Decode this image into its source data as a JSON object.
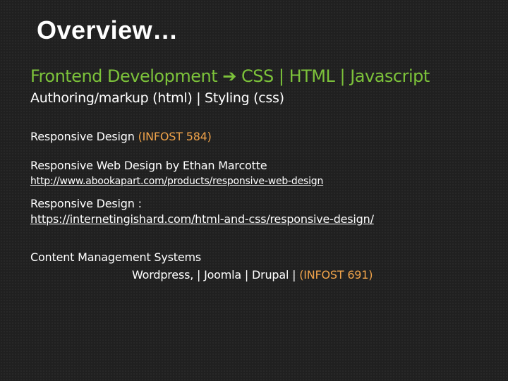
{
  "slide": {
    "title": "Overview…",
    "heading": {
      "left": "Frontend Development",
      "arrow": "➔",
      "right": "CSS | HTML | Javascript"
    },
    "subheading": "Authoring/markup (html) | Styling (css)",
    "responsive_design": {
      "label": "Responsive Design",
      "course": "(INFOST 584)"
    },
    "book": {
      "title": "Responsive Web Design by Ethan Marcotte",
      "link": "http://www.abookapart.com/products/responsive-web-design"
    },
    "responsive_design_2": {
      "label": "Responsive Design :",
      "link": "https://internetingishard.com/html-and-css/responsive-design/"
    },
    "cms": {
      "label": "Content Management Systems",
      "list": "Wordpress, | Joomla | Drupal |",
      "course": "(INFOST 691)"
    },
    "colors": {
      "heading": "#7cc23a",
      "accent": "#f0a34a",
      "background": "#202020"
    }
  }
}
